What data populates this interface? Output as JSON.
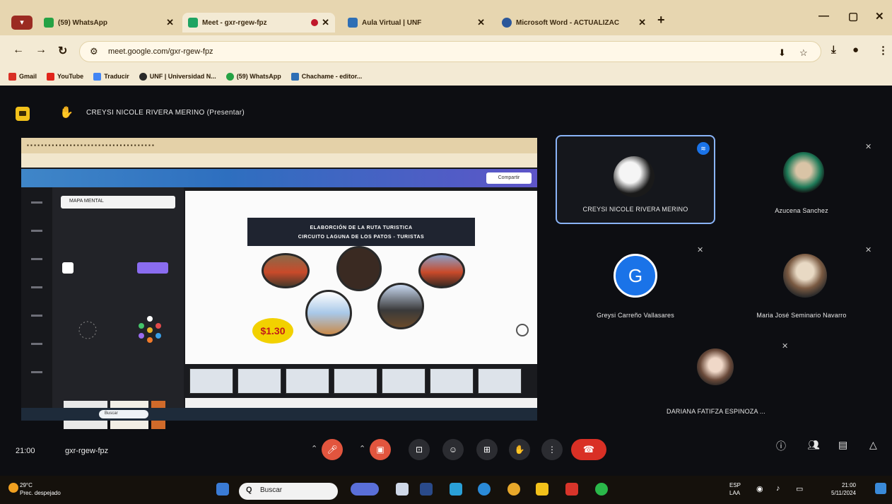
{
  "browser": {
    "tabs": [
      {
        "title": "(59) WhatsApp"
      },
      {
        "title": "Meet - gxr-rgew-fpz"
      },
      {
        "title": "Aula Virtual | UNF"
      },
      {
        "title": "Microsoft Word - ACTUALIZAC"
      }
    ],
    "url": "meet.google.com/gxr-rgew-fpz",
    "bookmarks": [
      "Gmail",
      "YouTube",
      "Traducir",
      "UNF | Universidad N...",
      "(59) WhatsApp",
      "Chachame - editor..."
    ]
  },
  "meet": {
    "presenter_label": "CREYSI NICOLE RIVERA MERINO (Presentar)",
    "participants": [
      {
        "name": "CREYSI NICOLE RIVERA MERINO"
      },
      {
        "name": "Azucena Sanchez"
      },
      {
        "name": "Greysi Carreño Vallasares",
        "initial": "G"
      },
      {
        "name": "Maria José Seminario Navarro"
      },
      {
        "name": "DARIANA FATIFZA ESPINOZA ..."
      }
    ],
    "time": "21:00",
    "meeting_code": "gxr-rgew-fpz"
  },
  "shared_screen": {
    "search_text": "MAPA MENTAL",
    "share_button": "Compartir",
    "slide_title_line1": "ELABORCIÓN DE LA RUTA TURISTICA",
    "slide_title_line2": "CIRCUITO LAGUNA DE LOS PATOS - TURISTAS",
    "price": "$1.30",
    "taskbar_search": "Buscar"
  },
  "taskbar": {
    "search_placeholder": "Buscar",
    "weather_line1": "29°C",
    "weather_line2": "Prec. despejado",
    "lang_line1": "ESP",
    "lang_line2": "LAA",
    "clock_time": "21:00",
    "clock_date": "5/11/2024"
  },
  "colors": {
    "chrome_bg": "#e7d6b0",
    "meet_bg": "#0d0e12",
    "hangup": "#d93025",
    "mic_off": "#e2553e",
    "google_blue": "#1a73e8"
  }
}
